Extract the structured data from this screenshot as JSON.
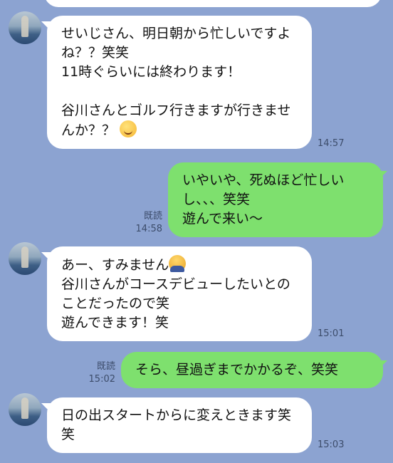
{
  "messages": [
    {
      "side": "in",
      "text": "せいじさん、明日朝から忙しいですよね？？笑笑\n11時ぐらいには終わります！\n\n谷川さんとゴルフ行きますが行きませんか？？",
      "emoji": "yum-face-emoji",
      "time": "14:57"
    },
    {
      "side": "out",
      "text": "いやいや、死ぬほど忙しいし、、、笑笑\n遊んで来い〜",
      "read": "既読",
      "time": "14:58"
    },
    {
      "side": "in",
      "text": "あー、すみません",
      "emoji": "bowing-person-emoji",
      "text2": "谷川さんがコースデビューしたいとのことだったので笑\n遊んできます！笑",
      "time": "15:01"
    },
    {
      "side": "out",
      "text": "そら、昼過ぎまでかかるぞ、笑笑",
      "read": "既読",
      "time": "15:02"
    },
    {
      "side": "in",
      "text": "日の出スタートからに変えときます笑笑",
      "time": "15:03"
    }
  ]
}
